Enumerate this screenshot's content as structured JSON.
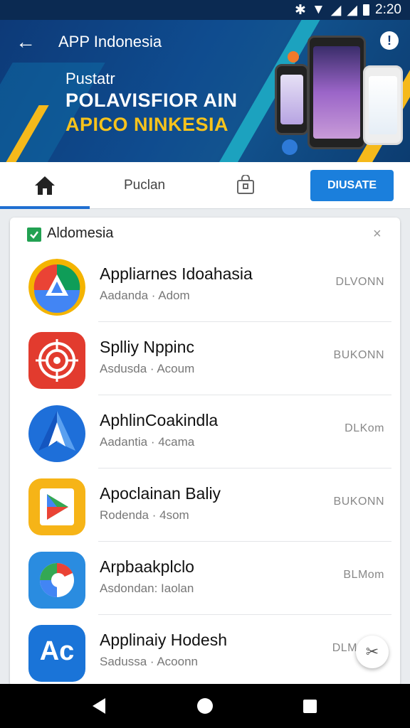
{
  "status_bar": {
    "time": "2:20",
    "icons": [
      "bluetooth-icon",
      "wifi-icon",
      "signal-icon",
      "signal-icon",
      "battery-icon"
    ]
  },
  "header": {
    "title": "APP Indonesia",
    "promo_small": "Pustatr",
    "promo_line1": "POLAVISFIOR AIN",
    "promo_line2": "APICO NINKESIA",
    "accent": "#f7c31c",
    "brand": "#0d3a78"
  },
  "tabs": {
    "home_icon": "home-icon",
    "label": "Puclan",
    "bag_icon": "shopping-bag-icon",
    "action_label": "DIUSATE"
  },
  "list": {
    "title": "Aldomesia",
    "close": "×",
    "items": [
      {
        "name": "Appliarnes Idoahasia",
        "sub": "Aadanda · Adom",
        "action": "DLVONN",
        "icon": "drive-icon"
      },
      {
        "name": "Splliy Nppinc",
        "sub": "Asdusda · Acoum",
        "action": "BUKONN",
        "icon": "target-icon"
      },
      {
        "name": "AphlinCoakindla",
        "sub": "Aadantia · 4cama",
        "action": "DLKom",
        "icon": "arrow-a-icon"
      },
      {
        "name": "Apoclainan Baliy",
        "sub": "Rodenda · 4som",
        "action": "BUKONN",
        "icon": "play-icon"
      },
      {
        "name": "Arpbaakplclo",
        "sub": "Asdondan: Iaolan",
        "action": "BLMom",
        "icon": "maps-icon"
      },
      {
        "name": "Applinaiy Hodesh",
        "sub": "Sadussa · Acoonn",
        "action": "DLM",
        "icon": "ac-icon"
      }
    ]
  },
  "fab_icon": "tools-icon",
  "navbar": {
    "back_icon": "back-triangle-icon",
    "home_icon": "home-circle-icon",
    "recent_icon": "recents-square-icon"
  }
}
